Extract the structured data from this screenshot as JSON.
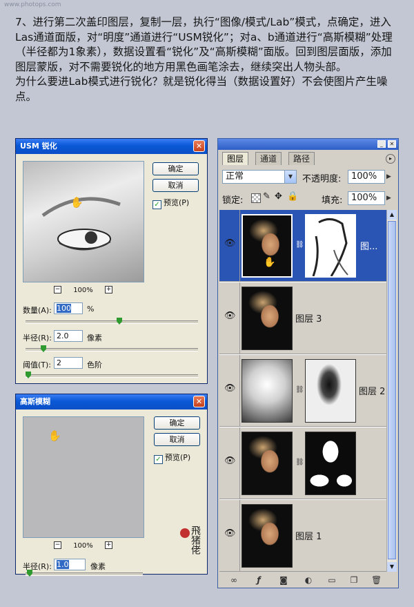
{
  "watermark": "www.photops.com",
  "instructions": {
    "p1": "7、进行第二次盖印图层，复制一层，执行“图像/模式/Lab”模式，点确定，进入Las通道面版，对“明度”通道进行“USM锐化”；对a、b通道进行“高斯模糊”处理（半径都为1象素），数据设置看“锐化”及“高斯模糊”面版。回到图层面版，添加图层蒙版，对不需要锐化的地方用黑色画笔涂去，继续突出人物头部。",
    "p2": "为什么要进Lab模式进行锐化？就是锐化得当（数据设置好）不会使图片产生噪点。"
  },
  "usm_dialog": {
    "title": "USM 锐化",
    "ok": "确定",
    "cancel": "取消",
    "preview": "预览(P)",
    "zoom": "100%",
    "amount_label": "数量(A):",
    "amount_value": "100",
    "amount_unit": "%",
    "radius_label": "半径(R):",
    "radius_value": "2.0",
    "radius_unit": "像素",
    "threshold_label": "阈值(T):",
    "threshold_value": "2",
    "threshold_unit": "色阶"
  },
  "gauss_dialog": {
    "title": "高斯模糊",
    "ok": "确定",
    "cancel": "取消",
    "preview": "预览(P)",
    "zoom": "100%",
    "radius_label": "半径(R):",
    "radius_value": "1.0",
    "radius_unit": "像素"
  },
  "layers_panel": {
    "tabs": [
      "图层",
      "通道",
      "路径"
    ],
    "blend_mode": "正常",
    "opacity_label": "不透明度:",
    "opacity_value": "100%",
    "lock_label": "锁定:",
    "fill_label": "填充:",
    "fill_value": "100%",
    "layers": [
      {
        "name": "图...",
        "selected": true
      },
      {
        "name": "图层 3",
        "selected": false
      },
      {
        "name": "图层 2",
        "selected": false
      },
      {
        "name": "",
        "selected": false
      },
      {
        "name": "图层 1",
        "selected": false
      }
    ]
  },
  "signature": "飛猪佬"
}
